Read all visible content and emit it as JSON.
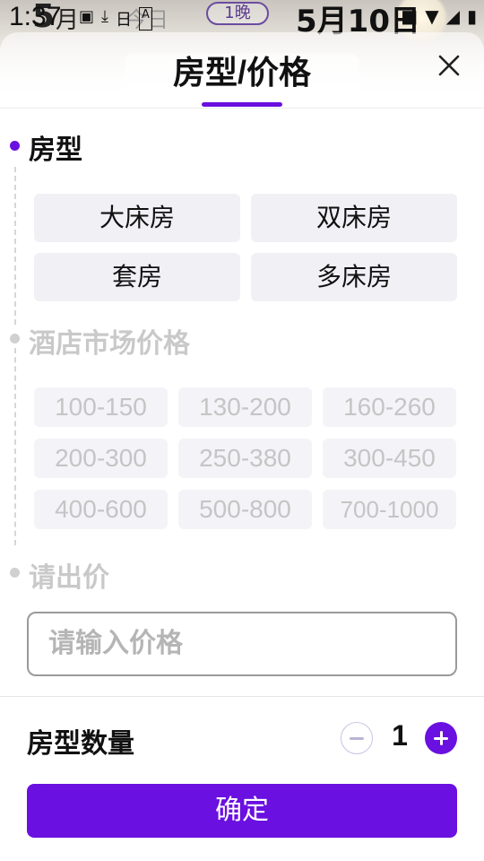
{
  "status_bar": {
    "time": "1:37",
    "check_in_day": "5",
    "check_in_month_char": "月",
    "check_in_suffix": "日",
    "check_in_ghost": "今日",
    "nights": "1晚",
    "check_out": "5月10日"
  },
  "sheet": {
    "title": "房型/价格"
  },
  "room_type": {
    "title": "房型",
    "options": [
      "大床房",
      "双床房",
      "套房",
      "多床房"
    ]
  },
  "market_price": {
    "title": "酒店市场价格",
    "options": [
      "100-150",
      "130-200",
      "160-260",
      "200-300",
      "250-380",
      "300-450",
      "400-600",
      "500-800",
      "700-1000"
    ]
  },
  "bid": {
    "title": "请出价",
    "placeholder": "请输入价格"
  },
  "quantity": {
    "label": "房型数量",
    "value": "1"
  },
  "confirm_label": "确定",
  "colors": {
    "accent": "#6a10e0",
    "chip_bg": "#f1f0f5",
    "muted_text": "#c5c5c5"
  }
}
